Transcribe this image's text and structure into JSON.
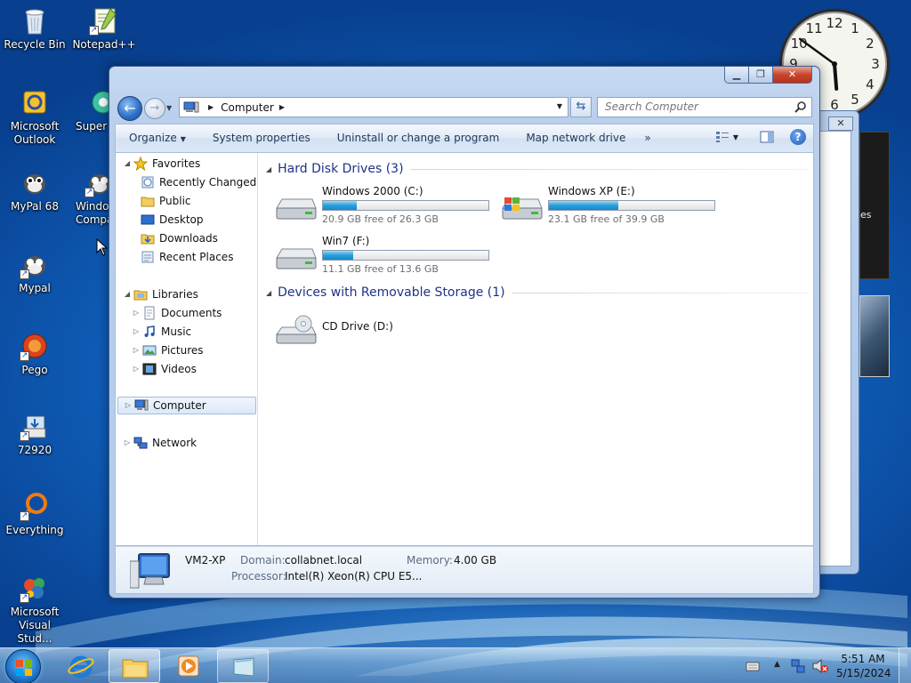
{
  "desktop": {
    "icons": [
      {
        "label": "Recycle Bin",
        "icon": "recycle-bin-icon"
      },
      {
        "label": "Notepad++",
        "icon": "notepadpp-icon"
      },
      {
        "label": "Microsoft Outlook",
        "icon": "outlook-icon"
      },
      {
        "label": "Super",
        "icon": "super-icon"
      },
      {
        "label": "MyPal 68",
        "icon": "mypal-icon"
      },
      {
        "label": "Windo Compat",
        "icon": "mypal-icon"
      },
      {
        "label": "Mypal",
        "icon": "mypal-icon"
      },
      {
        "label": "Pego",
        "icon": "pego-icon"
      },
      {
        "label": "72920",
        "icon": "installer-icon"
      },
      {
        "label": "Everything",
        "icon": "everything-icon"
      },
      {
        "label": "Microsoft Visual Stud...",
        "icon": "visual-studio-icon"
      }
    ]
  },
  "background_window": {
    "snippet": "es"
  },
  "window": {
    "title": "Computer",
    "address": {
      "crumb": "Computer"
    },
    "search": {
      "placeholder": "Search Computer"
    },
    "commands": {
      "organize": "Organize",
      "system_properties": "System properties",
      "uninstall": "Uninstall or change a program",
      "map_drive": "Map network drive",
      "more": "»"
    },
    "nav": {
      "favorites": "Favorites",
      "recently_changed": "Recently Changed",
      "public": "Public",
      "desktop": "Desktop",
      "downloads": "Downloads",
      "recent_places": "Recent Places",
      "libraries": "Libraries",
      "documents": "Documents",
      "music": "Music",
      "pictures": "Pictures",
      "videos": "Videos",
      "computer": "Computer",
      "network": "Network"
    },
    "groups": {
      "hdd": "Hard Disk Drives (3)",
      "removable": "Devices with Removable Storage (1)"
    },
    "drives": [
      {
        "name": "Windows 2000 (C:)",
        "free": "20.9 GB free of 26.3 GB",
        "used_fraction": 0.205
      },
      {
        "name": "Windows XP (E:)",
        "free": "23.1 GB free of 39.9 GB",
        "used_fraction": 0.421
      },
      {
        "name": "Win7 (F:)",
        "free": "11.1 GB free of 13.6 GB",
        "used_fraction": 0.184
      }
    ],
    "cd_drive": {
      "name": "CD Drive (D:)"
    },
    "details": {
      "computer_name": "VM2-XP",
      "domain_label": "Domain:",
      "domain_value": "collabnet.local",
      "memory_label": "Memory:",
      "memory_value": "4.00 GB",
      "processor_label": "Processor:",
      "processor_value": "Intel(R) Xeon(R) CPU E5..."
    }
  },
  "clock_gadget": {
    "time": {
      "hour": 5,
      "minute": 51
    }
  },
  "taskbar": {
    "time": "5:51 AM",
    "date": "5/15/2024"
  },
  "colors": {
    "desktop_blue": "#0f5db8",
    "group_header": "#1e3287",
    "drive_fill": "#26a0da",
    "close_red": "#c7452e"
  }
}
